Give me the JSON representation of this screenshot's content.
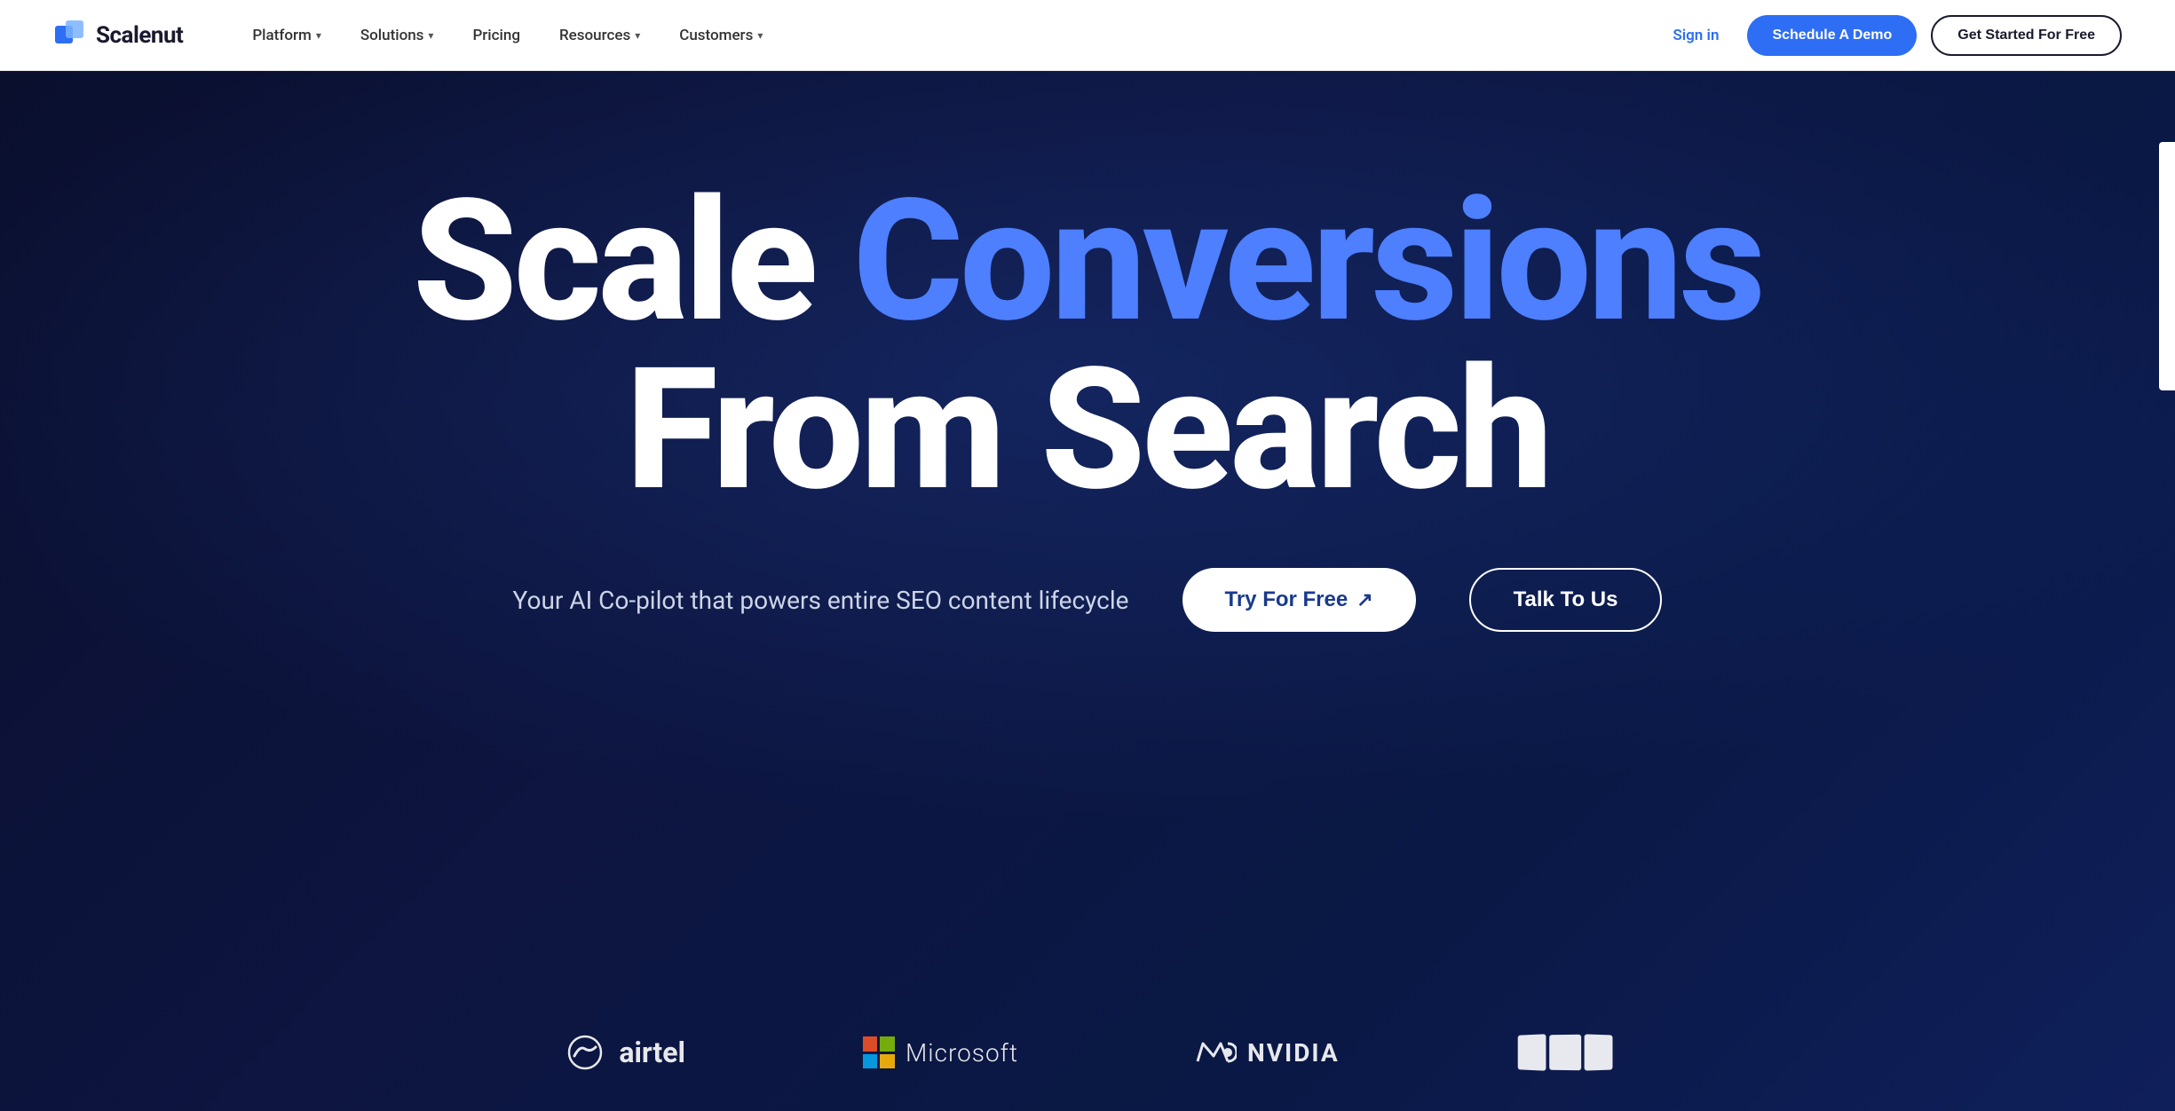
{
  "navbar": {
    "logo_text": "Scalenut",
    "nav_items": [
      {
        "label": "Platform",
        "has_dropdown": true
      },
      {
        "label": "Solutions",
        "has_dropdown": true
      },
      {
        "label": "Pricing",
        "has_dropdown": false
      },
      {
        "label": "Resources",
        "has_dropdown": true
      },
      {
        "label": "Customers",
        "has_dropdown": true
      }
    ],
    "sign_in_label": "Sign in",
    "schedule_demo_label": "Schedule A Demo",
    "get_started_label": "Get Started For Free"
  },
  "hero": {
    "headline_part1": "Scale ",
    "headline_part2": "Conversions",
    "headline_part3": "From Search",
    "subtitle": "Your AI Co-pilot that powers entire SEO content lifecycle",
    "try_free_label": "Try For Free",
    "try_free_arrow": "↗",
    "talk_to_us_label": "Talk To Us"
  },
  "brands": [
    {
      "name": "airtel",
      "label": "airtel"
    },
    {
      "name": "microsoft",
      "label": "Microsoft"
    },
    {
      "name": "nvidia",
      "label": "NVIDIA"
    },
    {
      "name": "unknown",
      "label": ""
    }
  ],
  "colors": {
    "hero_bg": "#0a0f2e",
    "accent_blue": "#4d7fff",
    "nav_bg": "#ffffff",
    "cta_blue": "#2d6ef5"
  }
}
